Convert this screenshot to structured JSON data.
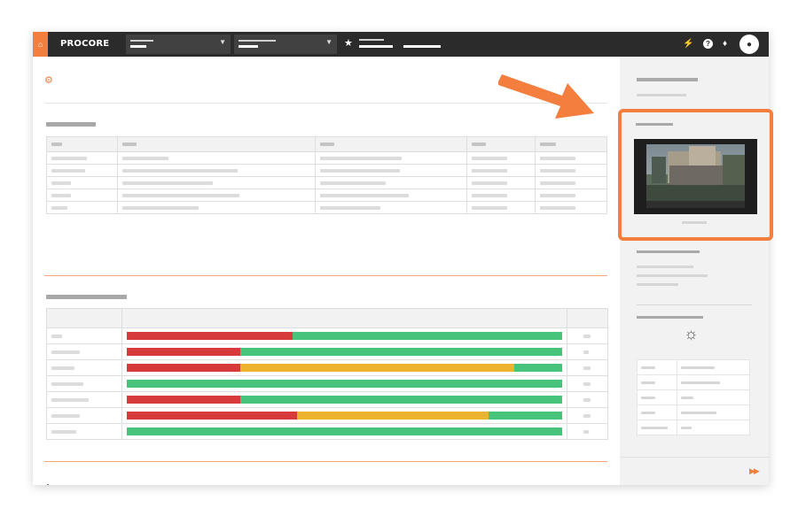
{
  "topbar": {
    "logo": "PROCORE",
    "icons": [
      "home-icon",
      "plug-icon",
      "help-icon",
      "bell-icon",
      "user-icon"
    ]
  },
  "main": {
    "settings_icon": "gear-icon",
    "table_1": {
      "rows": 5
    },
    "status_table": {
      "rows": [
        {
          "red": 38,
          "yellow": 0,
          "green": 62
        },
        {
          "red": 26,
          "yellow": 0,
          "green": 74
        },
        {
          "red": 26,
          "yellow": 63,
          "green": 11
        },
        {
          "red": 0,
          "yellow": 0,
          "green": 100
        },
        {
          "red": 26,
          "yellow": 0,
          "green": 74
        },
        {
          "red": 39,
          "yellow": 44,
          "green": 17
        },
        {
          "red": 0,
          "yellow": 0,
          "green": 100
        }
      ]
    },
    "expand_icon": "chevron-right-icon"
  },
  "sidebar": {
    "weather_icon": "sun-icon",
    "footer_icon": "fast-forward-icon"
  },
  "annotation": {
    "color": "#f47e3e",
    "arrow": "arrow-icon"
  },
  "colors": {
    "red": "#d63a3a",
    "yellow": "#edb32e",
    "green": "#47c37c",
    "accent": "#f47e3e",
    "topbar": "#2b2b2b"
  }
}
